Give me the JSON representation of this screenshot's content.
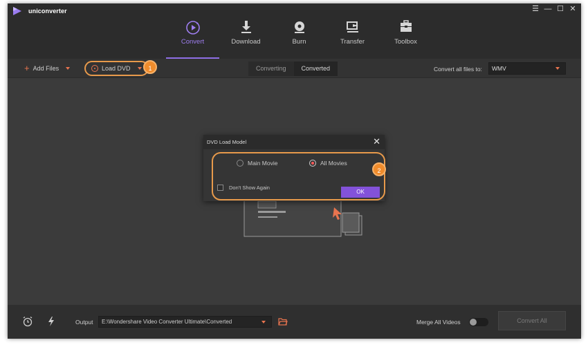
{
  "app": {
    "title": "uniconverter"
  },
  "window_controls": {
    "menu": "☰",
    "minimize": "—",
    "maximize": "☐",
    "close": "✕"
  },
  "tabs": [
    {
      "label": "Convert",
      "icon": "convert-icon",
      "active": true
    },
    {
      "label": "Download",
      "icon": "download-icon",
      "active": false
    },
    {
      "label": "Burn",
      "icon": "burn-icon",
      "active": false
    },
    {
      "label": "Transfer",
      "icon": "transfer-icon",
      "active": false
    },
    {
      "label": "Toolbox",
      "icon": "toolbox-icon",
      "active": false
    }
  ],
  "toolbar": {
    "add_files": "Add Files",
    "load_dvd": "Load DVD",
    "segment": {
      "converting": "Converting",
      "converted": "Converted",
      "selected": "Converting"
    },
    "convert_all_label": "Convert all files to:",
    "format_value": "WMV"
  },
  "callouts": {
    "one": "1",
    "two": "2"
  },
  "dialog": {
    "title": "DVD Load Model",
    "close": "✕",
    "options": [
      {
        "label": "Main Movie",
        "selected": false
      },
      {
        "label": "All Movies",
        "selected": true
      }
    ],
    "dont_show": "Don't Show Again",
    "ok": "OK"
  },
  "bottom": {
    "output_label": "Output",
    "output_path": "E:\\Wondershare Video Converter Ultimate\\Converted",
    "merge_label": "Merge All Videos",
    "merge_on": false,
    "convert_all": "Convert All"
  },
  "colors": {
    "accent_purple": "#8e6ee6",
    "accent_orange": "#e8744f",
    "highlight": "#f08c2c",
    "background": "#3b3b3b"
  }
}
